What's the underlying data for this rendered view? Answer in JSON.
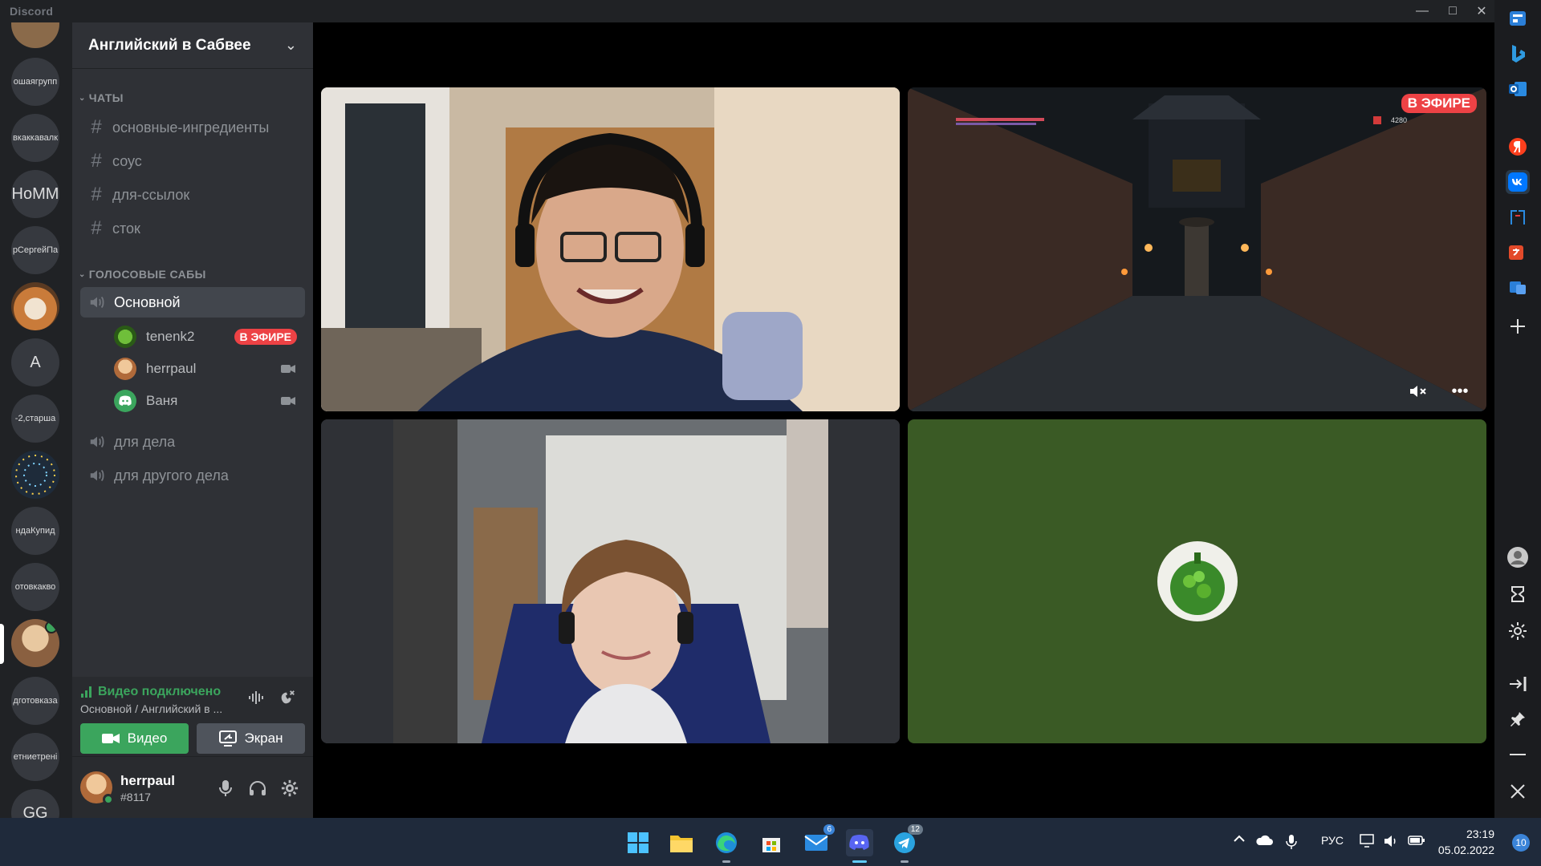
{
  "window": {
    "brand": "Discord"
  },
  "rail": {
    "servers": [
      {
        "label": ""
      },
      {
        "label": "ошаягрупп"
      },
      {
        "label": "вкаккавалк"
      },
      {
        "label": "HoMM"
      },
      {
        "label": "рСергейПа"
      },
      {
        "label": ""
      },
      {
        "label": "A"
      },
      {
        "label": "-2,старша"
      },
      {
        "label": ""
      },
      {
        "label": "ндаКупид"
      },
      {
        "label": "отовкакво"
      },
      {
        "label": ""
      },
      {
        "label": "дготовказа"
      },
      {
        "label": "етниетрені"
      },
      {
        "label": "GG"
      }
    ]
  },
  "guild": {
    "name": "Английский в Сабвее"
  },
  "categories": {
    "text": "ЧАТЫ",
    "voice": "ГОЛОСОВЫЕ САБЫ"
  },
  "text_channels": [
    "основные-ингредиенты",
    "соус",
    "для-ссылок",
    "сток"
  ],
  "voice_channels": {
    "active": "Основной",
    "others": [
      "для дела",
      "для другого дела"
    ]
  },
  "members": [
    {
      "name": "tenenk2",
      "badge": "В ЭФИРЕ"
    },
    {
      "name": "herrpaul"
    },
    {
      "name": "Ваня"
    }
  ],
  "voice_panel": {
    "status": "Видео подключено",
    "location": "Основной / Английский в ...",
    "video_label": "Видео",
    "screen_label": "Экран"
  },
  "user": {
    "name": "herrpaul",
    "tag": "#8117"
  },
  "stage": {
    "live_badge": "В ЭФИРЕ",
    "stream_score": "4280"
  },
  "taskbar": {
    "mail_badge": "6",
    "telegram_badge": "12",
    "lang": "РУС",
    "time": "23:19",
    "date": "05.02.2022",
    "notifications": "10"
  },
  "colors": {
    "accent_green": "#3ba55d",
    "live_red": "#ed4245",
    "blurple": "#5865f2"
  }
}
